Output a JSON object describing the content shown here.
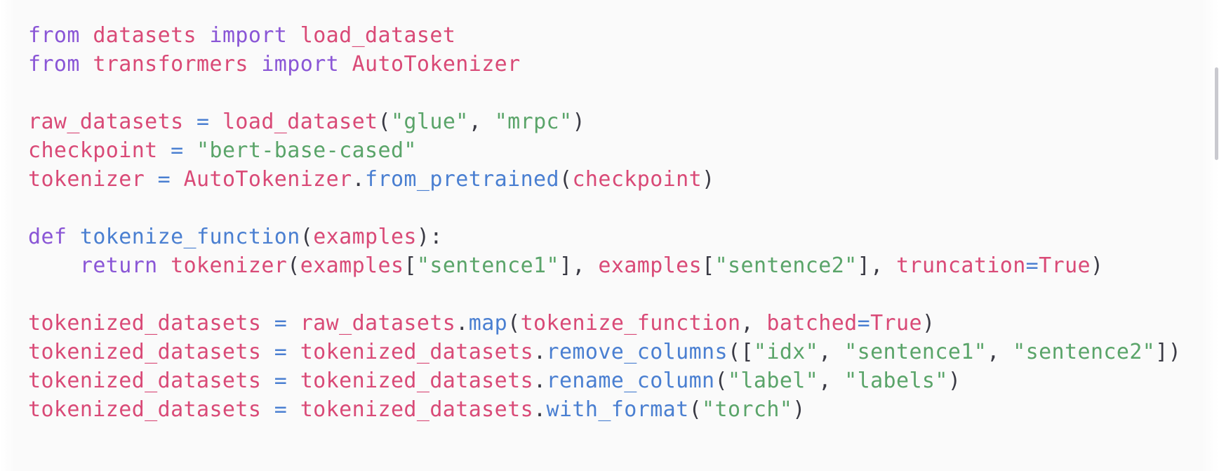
{
  "viewer": {
    "background_color": "#fafafa",
    "language": "python"
  },
  "theme": {
    "keyword_color": "#8a56d6",
    "name_color": "#d94a77",
    "function_color": "#4a7fd1",
    "string_color": "#5aa469",
    "punctuation_color": "#3a3a44",
    "background_color": "#fafafa"
  },
  "scrollbar": {
    "name": "vertical-scrollbar",
    "thumb_color": "#c9c9cf"
  },
  "code": {
    "lines": [
      {
        "index": 0,
        "text": "from datasets import load_dataset",
        "tokens": [
          {
            "t": "from",
            "c": "keyword"
          },
          {
            "t": " ",
            "c": "plain"
          },
          {
            "t": "datasets",
            "c": "name"
          },
          {
            "t": " ",
            "c": "plain"
          },
          {
            "t": "import",
            "c": "keyword"
          },
          {
            "t": " ",
            "c": "plain"
          },
          {
            "t": "load_dataset",
            "c": "name"
          }
        ]
      },
      {
        "index": 1,
        "text": "from transformers import AutoTokenizer",
        "tokens": [
          {
            "t": "from",
            "c": "keyword"
          },
          {
            "t": " ",
            "c": "plain"
          },
          {
            "t": "transformers",
            "c": "name"
          },
          {
            "t": " ",
            "c": "plain"
          },
          {
            "t": "import",
            "c": "keyword"
          },
          {
            "t": " ",
            "c": "plain"
          },
          {
            "t": "AutoTokenizer",
            "c": "name"
          }
        ]
      },
      {
        "index": 2,
        "text": "",
        "tokens": []
      },
      {
        "index": 3,
        "text": "raw_datasets = load_dataset(\"glue\", \"mrpc\")",
        "tokens": [
          {
            "t": "raw_datasets",
            "c": "name"
          },
          {
            "t": " ",
            "c": "plain"
          },
          {
            "t": "=",
            "c": "operator"
          },
          {
            "t": " ",
            "c": "plain"
          },
          {
            "t": "load_dataset",
            "c": "name"
          },
          {
            "t": "(",
            "c": "punct"
          },
          {
            "t": "\"glue\"",
            "c": "string"
          },
          {
            "t": ",",
            "c": "punct"
          },
          {
            "t": " ",
            "c": "plain"
          },
          {
            "t": "\"mrpc\"",
            "c": "string"
          },
          {
            "t": ")",
            "c": "punct"
          }
        ]
      },
      {
        "index": 4,
        "text": "checkpoint = \"bert-base-cased\"",
        "tokens": [
          {
            "t": "checkpoint",
            "c": "name"
          },
          {
            "t": " ",
            "c": "plain"
          },
          {
            "t": "=",
            "c": "operator"
          },
          {
            "t": " ",
            "c": "plain"
          },
          {
            "t": "\"bert-base-cased\"",
            "c": "string"
          }
        ]
      },
      {
        "index": 5,
        "text": "tokenizer = AutoTokenizer.from_pretrained(checkpoint)",
        "tokens": [
          {
            "t": "tokenizer",
            "c": "name"
          },
          {
            "t": " ",
            "c": "plain"
          },
          {
            "t": "=",
            "c": "operator"
          },
          {
            "t": " ",
            "c": "plain"
          },
          {
            "t": "AutoTokenizer",
            "c": "name"
          },
          {
            "t": ".",
            "c": "punct"
          },
          {
            "t": "from_pretrained",
            "c": "func"
          },
          {
            "t": "(",
            "c": "punct"
          },
          {
            "t": "checkpoint",
            "c": "name"
          },
          {
            "t": ")",
            "c": "punct"
          }
        ]
      },
      {
        "index": 6,
        "text": "",
        "tokens": []
      },
      {
        "index": 7,
        "text": "def tokenize_function(examples):",
        "tokens": [
          {
            "t": "def",
            "c": "keyword"
          },
          {
            "t": " ",
            "c": "plain"
          },
          {
            "t": "tokenize_function",
            "c": "func"
          },
          {
            "t": "(",
            "c": "punct"
          },
          {
            "t": "examples",
            "c": "name"
          },
          {
            "t": ")",
            "c": "punct"
          },
          {
            "t": ":",
            "c": "punct"
          }
        ]
      },
      {
        "index": 8,
        "text": "    return tokenizer(examples[\"sentence1\"], examples[\"sentence2\"], truncation=True)",
        "tokens": [
          {
            "t": "    ",
            "c": "plain"
          },
          {
            "t": "return",
            "c": "keyword"
          },
          {
            "t": " ",
            "c": "plain"
          },
          {
            "t": "tokenizer",
            "c": "name"
          },
          {
            "t": "(",
            "c": "punct"
          },
          {
            "t": "examples",
            "c": "name"
          },
          {
            "t": "[",
            "c": "punct"
          },
          {
            "t": "\"sentence1\"",
            "c": "string"
          },
          {
            "t": "]",
            "c": "punct"
          },
          {
            "t": ",",
            "c": "punct"
          },
          {
            "t": " ",
            "c": "plain"
          },
          {
            "t": "examples",
            "c": "name"
          },
          {
            "t": "[",
            "c": "punct"
          },
          {
            "t": "\"sentence2\"",
            "c": "string"
          },
          {
            "t": "]",
            "c": "punct"
          },
          {
            "t": ",",
            "c": "punct"
          },
          {
            "t": " ",
            "c": "plain"
          },
          {
            "t": "truncation",
            "c": "name"
          },
          {
            "t": "=",
            "c": "operator"
          },
          {
            "t": "True",
            "c": "name"
          },
          {
            "t": ")",
            "c": "punct"
          }
        ]
      },
      {
        "index": 9,
        "text": "",
        "tokens": []
      },
      {
        "index": 10,
        "text": "tokenized_datasets = raw_datasets.map(tokenize_function, batched=True)",
        "tokens": [
          {
            "t": "tokenized_datasets",
            "c": "name"
          },
          {
            "t": " ",
            "c": "plain"
          },
          {
            "t": "=",
            "c": "operator"
          },
          {
            "t": " ",
            "c": "plain"
          },
          {
            "t": "raw_datasets",
            "c": "name"
          },
          {
            "t": ".",
            "c": "punct"
          },
          {
            "t": "map",
            "c": "func"
          },
          {
            "t": "(",
            "c": "punct"
          },
          {
            "t": "tokenize_function",
            "c": "name"
          },
          {
            "t": ",",
            "c": "punct"
          },
          {
            "t": " ",
            "c": "plain"
          },
          {
            "t": "batched",
            "c": "name"
          },
          {
            "t": "=",
            "c": "operator"
          },
          {
            "t": "True",
            "c": "name"
          },
          {
            "t": ")",
            "c": "punct"
          }
        ]
      },
      {
        "index": 11,
        "text": "tokenized_datasets = tokenized_datasets.remove_columns([\"idx\", \"sentence1\", \"sentence2\"])",
        "tokens": [
          {
            "t": "tokenized_datasets",
            "c": "name"
          },
          {
            "t": " ",
            "c": "plain"
          },
          {
            "t": "=",
            "c": "operator"
          },
          {
            "t": " ",
            "c": "plain"
          },
          {
            "t": "tokenized_datasets",
            "c": "name"
          },
          {
            "t": ".",
            "c": "punct"
          },
          {
            "t": "remove_columns",
            "c": "func"
          },
          {
            "t": "(",
            "c": "punct"
          },
          {
            "t": "[",
            "c": "punct"
          },
          {
            "t": "\"idx\"",
            "c": "string"
          },
          {
            "t": ",",
            "c": "punct"
          },
          {
            "t": " ",
            "c": "plain"
          },
          {
            "t": "\"sentence1\"",
            "c": "string"
          },
          {
            "t": ",",
            "c": "punct"
          },
          {
            "t": " ",
            "c": "plain"
          },
          {
            "t": "\"sentence2\"",
            "c": "string"
          },
          {
            "t": "]",
            "c": "punct"
          },
          {
            "t": ")",
            "c": "punct"
          }
        ]
      },
      {
        "index": 12,
        "text": "tokenized_datasets = tokenized_datasets.rename_column(\"label\", \"labels\")",
        "tokens": [
          {
            "t": "tokenized_datasets",
            "c": "name"
          },
          {
            "t": " ",
            "c": "plain"
          },
          {
            "t": "=",
            "c": "operator"
          },
          {
            "t": " ",
            "c": "plain"
          },
          {
            "t": "tokenized_datasets",
            "c": "name"
          },
          {
            "t": ".",
            "c": "punct"
          },
          {
            "t": "rename_column",
            "c": "func"
          },
          {
            "t": "(",
            "c": "punct"
          },
          {
            "t": "\"label\"",
            "c": "string"
          },
          {
            "t": ",",
            "c": "punct"
          },
          {
            "t": " ",
            "c": "plain"
          },
          {
            "t": "\"labels\"",
            "c": "string"
          },
          {
            "t": ")",
            "c": "punct"
          }
        ]
      },
      {
        "index": 13,
        "text": "tokenized_datasets = tokenized_datasets.with_format(\"torch\")",
        "tokens": [
          {
            "t": "tokenized_datasets",
            "c": "name"
          },
          {
            "t": " ",
            "c": "plain"
          },
          {
            "t": "=",
            "c": "operator"
          },
          {
            "t": " ",
            "c": "plain"
          },
          {
            "t": "tokenized_datasets",
            "c": "name"
          },
          {
            "t": ".",
            "c": "punct"
          },
          {
            "t": "with_format",
            "c": "func"
          },
          {
            "t": "(",
            "c": "punct"
          },
          {
            "t": "\"torch\"",
            "c": "string"
          },
          {
            "t": ")",
            "c": "punct"
          }
        ]
      }
    ]
  }
}
